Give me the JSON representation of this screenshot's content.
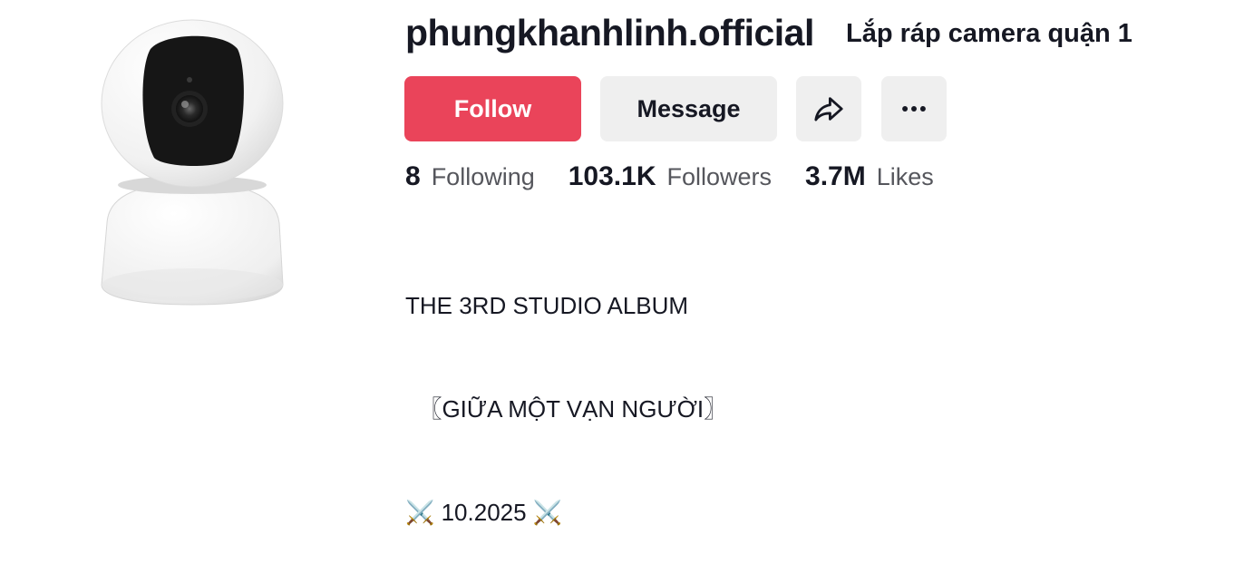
{
  "profile": {
    "username": "phungkhanhlinh.official",
    "nickname": "Lắp ráp camera quận 1",
    "avatar_icon": "security-camera-icon"
  },
  "actions": {
    "follow_label": "Follow",
    "message_label": "Message",
    "share_icon": "share-arrow-icon",
    "more_icon": "more-dots-icon"
  },
  "stats": {
    "following_count": "8",
    "following_label": "Following",
    "followers_count": "103.1K",
    "followers_label": "Followers",
    "likes_count": "3.7M",
    "likes_label": "Likes"
  },
  "bio": {
    "lines": [
      "THE 3RD STUDIO ALBUM",
      "  〖GIỮA MỘT VẠN NGƯỜI〗",
      "⚔️ 10.2025 ⚔️"
    ]
  },
  "colors": {
    "follow_button": "#ea445a",
    "secondary_button": "#efefef",
    "text_primary": "#161823",
    "text_secondary": "#55565c"
  }
}
